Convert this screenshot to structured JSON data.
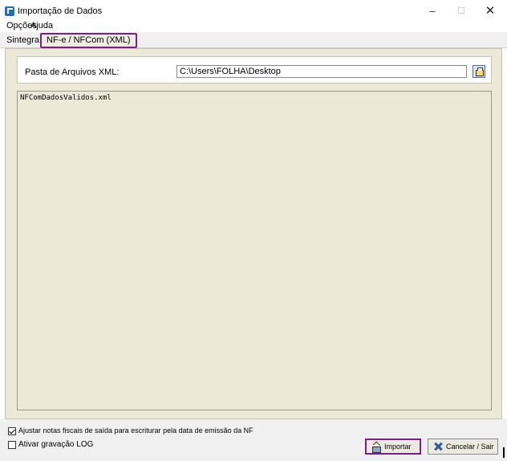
{
  "window": {
    "title": "Importação de Dados",
    "minimize": "–",
    "maximize": "☐",
    "close": "✕"
  },
  "menu": {
    "items": [
      "Opções",
      "Ajuda"
    ]
  },
  "tabs": [
    {
      "label": "Sintegra",
      "active": false
    },
    {
      "label": "NF-e / NFCom (XML)",
      "active": true
    }
  ],
  "xml_folder": {
    "label": "Pasta de Arquivos XML:",
    "value": "C:\\Users\\FOLHA\\Desktop"
  },
  "file_list": {
    "items": [
      "NFComDadosValidos.xml"
    ]
  },
  "options": {
    "adjust_notes_label": "Ajustar notas fiscais de saída para escriturar pela data de emissão da NF",
    "adjust_notes_checked": true,
    "log_label": "Ativar gravação LOG",
    "log_checked": false
  },
  "buttons": {
    "import_label": "Importar",
    "cancel_label": "Cancelar / Sair"
  },
  "colors": {
    "highlight": "#7a1e8c",
    "panel": "#ece9d8"
  }
}
